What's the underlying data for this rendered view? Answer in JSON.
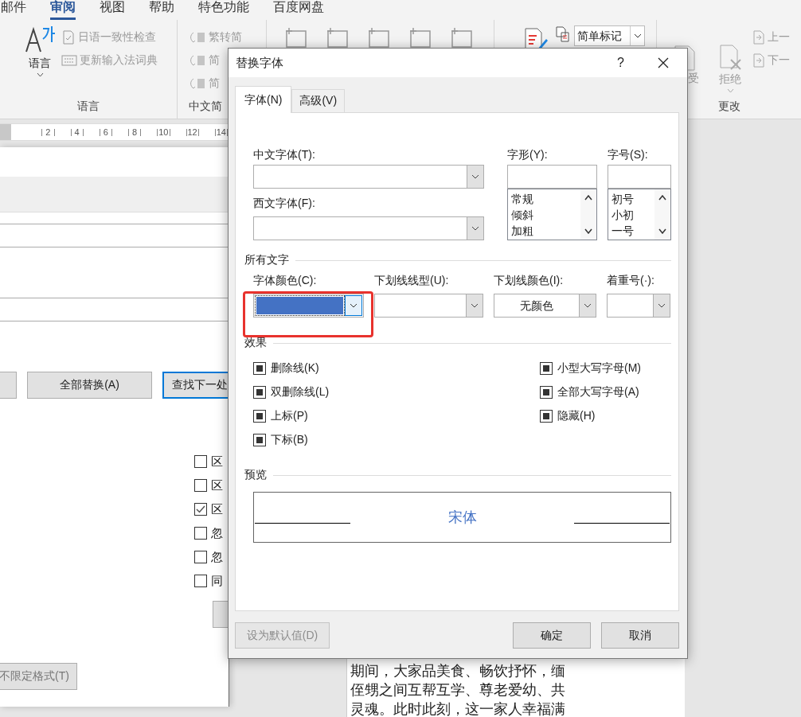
{
  "menu_tabs": [
    {
      "label": "邮件",
      "selected": false
    },
    {
      "label": "审阅",
      "selected": true
    },
    {
      "label": "视图",
      "selected": false
    },
    {
      "label": "帮助",
      "selected": false
    },
    {
      "label": "特色功能",
      "selected": false
    },
    {
      "label": "百度网盘",
      "selected": false
    }
  ],
  "ribbon": {
    "groups": [
      {
        "kind": "language",
        "label": "语言",
        "big_button": "语言",
        "items": [
          {
            "label": "日语一致性检查",
            "disabled": true
          },
          {
            "label": "更新输入法词典",
            "disabled": true
          }
        ]
      },
      {
        "kind": "chinese",
        "label": "中文简",
        "items": [
          {
            "label": "繁转简",
            "disabled": true
          },
          {
            "label": "简",
            "disabled": true
          },
          {
            "label": "简",
            "disabled": true
          }
        ]
      },
      {
        "kind": "comments"
      },
      {
        "kind": "markup",
        "dropdown": "简单标记"
      },
      {
        "kind": "changes",
        "label": "更改",
        "accept": "受",
        "reject": "拒绝",
        "items": [
          {
            "label": "上一",
            "disabled": true
          },
          {
            "label": "下一",
            "disabled": true
          }
        ]
      }
    ]
  },
  "ruler": {
    "ticks": [
      "2",
      "4",
      "6",
      "8",
      "10",
      "12",
      "14"
    ]
  },
  "find_dialog": {
    "buttons": [
      {
        "label": "全部替换(A)",
        "focused": false
      },
      {
        "label": "查找下一处",
        "focused": true
      }
    ],
    "options": [
      {
        "label": "区",
        "checked": false
      },
      {
        "label": "区",
        "checked": false
      },
      {
        "label": "区",
        "checked": true
      },
      {
        "label": "忽",
        "checked": false
      },
      {
        "label": "忽",
        "checked": false
      },
      {
        "label": "同",
        "checked": false
      }
    ],
    "format_button": "不限定格式(T)"
  },
  "document": {
    "lines": [
      "期间，大家品美食、畅饮抒怀，缅",
      "侄甥之间互帮互学、尊老爱幼、共",
      "灵魂。此时此刻，这一家人幸福满"
    ]
  },
  "font_dialog": {
    "title": "替换字体",
    "help": "?",
    "tabs": [
      {
        "label": "字体(N)",
        "selected": true
      },
      {
        "label": "高级(V)",
        "selected": false
      }
    ],
    "chinese_font": {
      "label": "中文字体(T):"
    },
    "western_font": {
      "label": "西文字体(F):"
    },
    "style": {
      "label": "字形(Y):",
      "options": [
        "常规",
        "倾斜",
        "加粗"
      ]
    },
    "size": {
      "label": "字号(S):",
      "options": [
        "初号",
        "小初",
        "一号"
      ]
    },
    "all_text": {
      "heading": "所有文字",
      "fields": [
        {
          "kind": "color",
          "label": "字体颜色(C):",
          "color": "#4472c4",
          "highlighted": true
        },
        {
          "kind": "combo",
          "label": "下划线线型(U):"
        },
        {
          "kind": "combo",
          "label": "下划线颜色(I):",
          "value": "无颜色"
        },
        {
          "kind": "combo",
          "label": "着重号(·):"
        }
      ]
    },
    "effects": {
      "heading": "效果",
      "left": [
        {
          "label": "删除线(K)",
          "indeterminate": true
        },
        {
          "label": "双删除线(L)",
          "indeterminate": true
        },
        {
          "label": "上标(P)",
          "indeterminate": true
        },
        {
          "label": "下标(B)",
          "indeterminate": true
        }
      ],
      "right": [
        {
          "label": "小型大写字母(M)",
          "indeterminate": true
        },
        {
          "label": "全部大写字母(A)",
          "indeterminate": true
        },
        {
          "label": "隐藏(H)",
          "indeterminate": true
        }
      ]
    },
    "preview": {
      "heading": "预览",
      "sample": "宋体"
    },
    "buttons": [
      {
        "label": "设为默认值(D)",
        "disabled": true
      },
      {
        "label": "确定",
        "disabled": false
      },
      {
        "label": "取消",
        "disabled": false
      }
    ]
  }
}
